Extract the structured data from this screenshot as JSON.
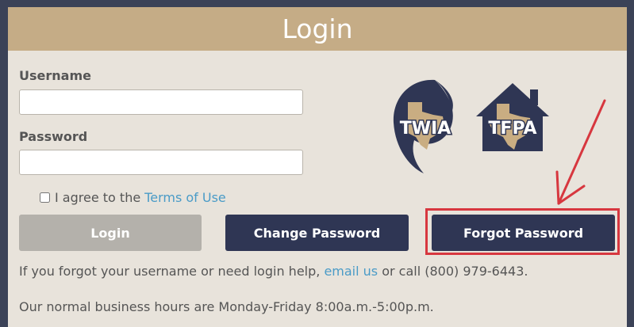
{
  "panel": {
    "title": "Login"
  },
  "form": {
    "username_label": "Username",
    "username_value": "",
    "password_label": "Password",
    "password_value": "",
    "terms_prefix": "I agree to the",
    "terms_link": "Terms of Use",
    "terms_checked": false
  },
  "buttons": {
    "login": "Login",
    "change_password": "Change Password",
    "forgot_password": "Forgot Password"
  },
  "help": {
    "prefix": "If you forgot your username or need login help,",
    "email_link": "email us",
    "suffix": "or call (800) 979-6443.",
    "hours": "Our normal business hours are Monday-Friday 8:00a.m.-5:00p.m."
  },
  "logos": {
    "twia": "TWIA",
    "tfpa": "TFPA"
  },
  "colors": {
    "background": "#3b4257",
    "panel": "#e8e3db",
    "header": "#c5ac86",
    "navy": "#2f3654",
    "disabled_button": "#b4b1ab",
    "link": "#4a9bc7",
    "annotation_red": "#d7373f",
    "texas_tan": "#c9ad82"
  },
  "icons": {
    "twia_logo": "hurricane-texas-icon",
    "tfpa_logo": "house-texas-icon",
    "annotation_arrow": "red-arrow-icon"
  }
}
